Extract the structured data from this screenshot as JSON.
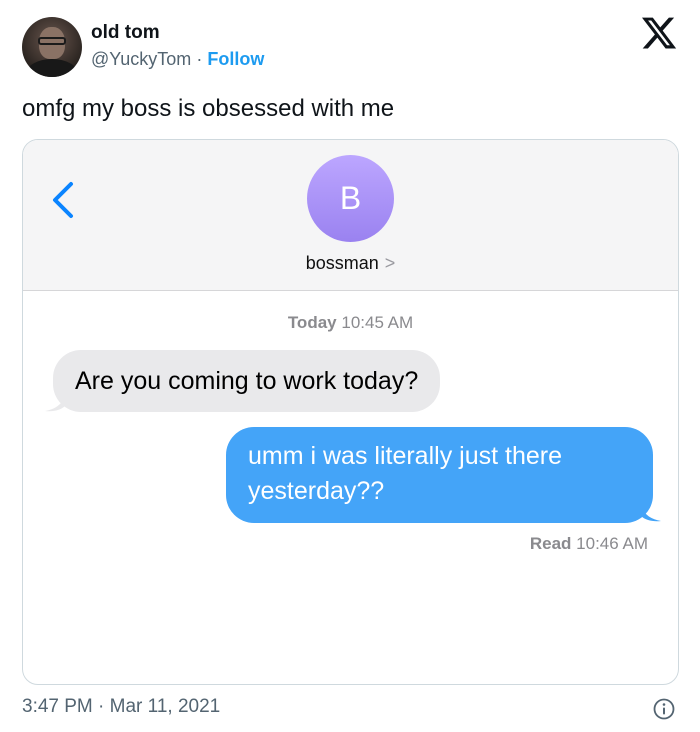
{
  "author": {
    "name": "old tom",
    "handle": "@YuckyTom",
    "separator": "·",
    "follow_label": "Follow"
  },
  "tweet": {
    "text": "omfg my boss is obsessed with me",
    "posted_time": "3:47 PM",
    "date_separator": "·",
    "posted_date": "Mar 11, 2021"
  },
  "imessage": {
    "contact_initial": "B",
    "contact_name": "bossman",
    "contact_chevron": ">",
    "day_label": "Today",
    "first_time": "10:45 AM",
    "messages": [
      {
        "direction": "incoming",
        "text": "Are you coming to work today?"
      },
      {
        "direction": "outgoing",
        "text": "umm i was literally just there yesterday??"
      }
    ],
    "read_label": "Read",
    "read_time": "10:46 AM"
  },
  "icons": {
    "brand": "x-logo-icon",
    "info": "info-icon",
    "back": "chevron-left-icon"
  },
  "colors": {
    "follow_blue": "#1d9bf0",
    "outgoing_bubble": "#44a4f8",
    "incoming_bubble": "#e9e9eb",
    "contact_avatar": "#a992f6",
    "ios_blue": "#0a84ff"
  }
}
